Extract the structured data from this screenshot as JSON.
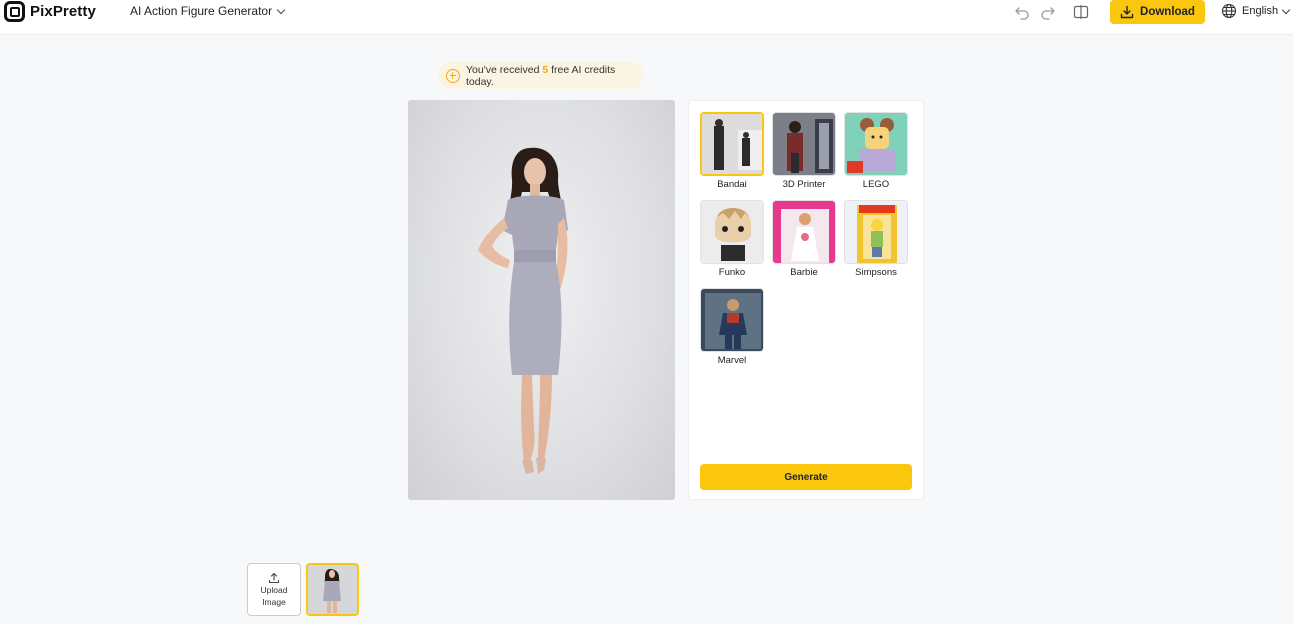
{
  "header": {
    "logo_text": "PixPretty",
    "tool_name": "AI Action Figure Generator",
    "download_label": "Download",
    "language": "English"
  },
  "credits": {
    "prefix": "You've received",
    "count": "5",
    "suffix": "free AI credits today."
  },
  "styles": {
    "items": [
      {
        "label": "Bandai",
        "selected": true
      },
      {
        "label": "3D Printer",
        "selected": false
      },
      {
        "label": "LEGO",
        "selected": false
      },
      {
        "label": "Funko",
        "selected": false
      },
      {
        "label": "Barbie",
        "selected": false
      },
      {
        "label": "Simpsons",
        "selected": false
      },
      {
        "label": "Marvel",
        "selected": false
      }
    ],
    "generate_label": "Generate"
  },
  "uploads": {
    "upload_label": "Upload\nImage"
  },
  "colors": {
    "accent": "#fbc70e",
    "credit_highlight": "#f3a619",
    "banner_bg": "#fcf4e3"
  }
}
